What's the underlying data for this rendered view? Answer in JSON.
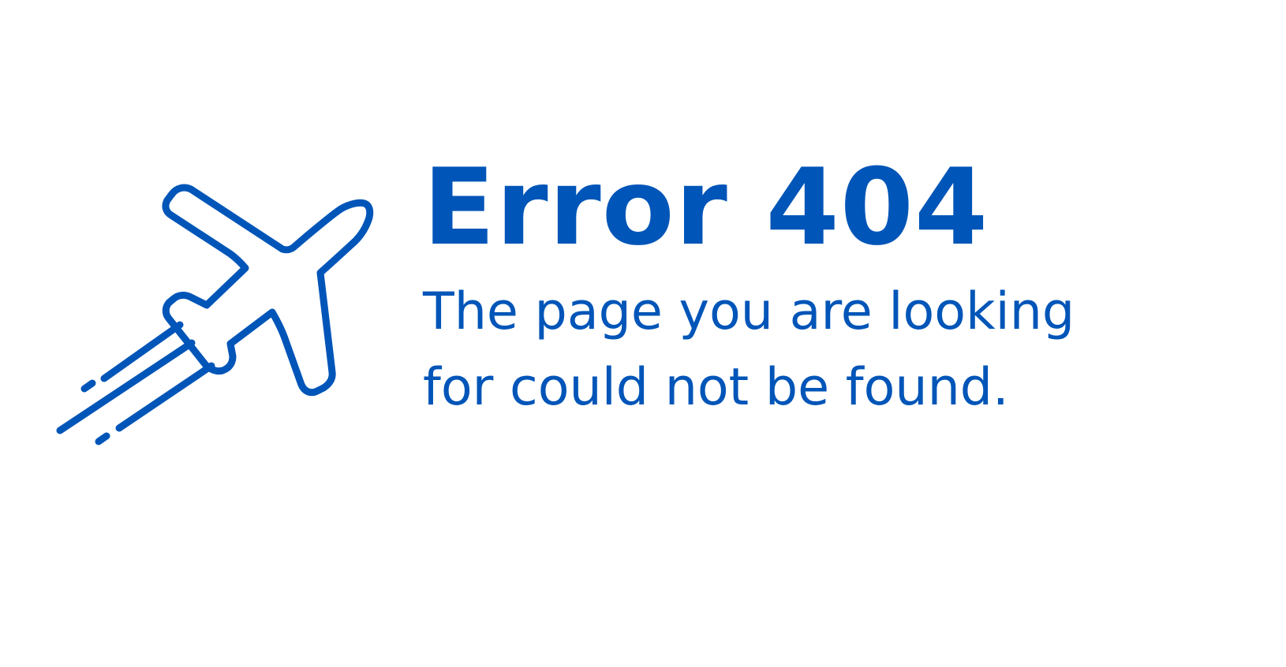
{
  "error": {
    "title": "Error 404",
    "message": "The page you are looking for could not be found."
  },
  "illustration": {
    "icon": "airplane-takeoff-icon",
    "color": "#0055B8"
  },
  "theme": {
    "background": "#FFFFFF",
    "accent": "#0055B8"
  }
}
